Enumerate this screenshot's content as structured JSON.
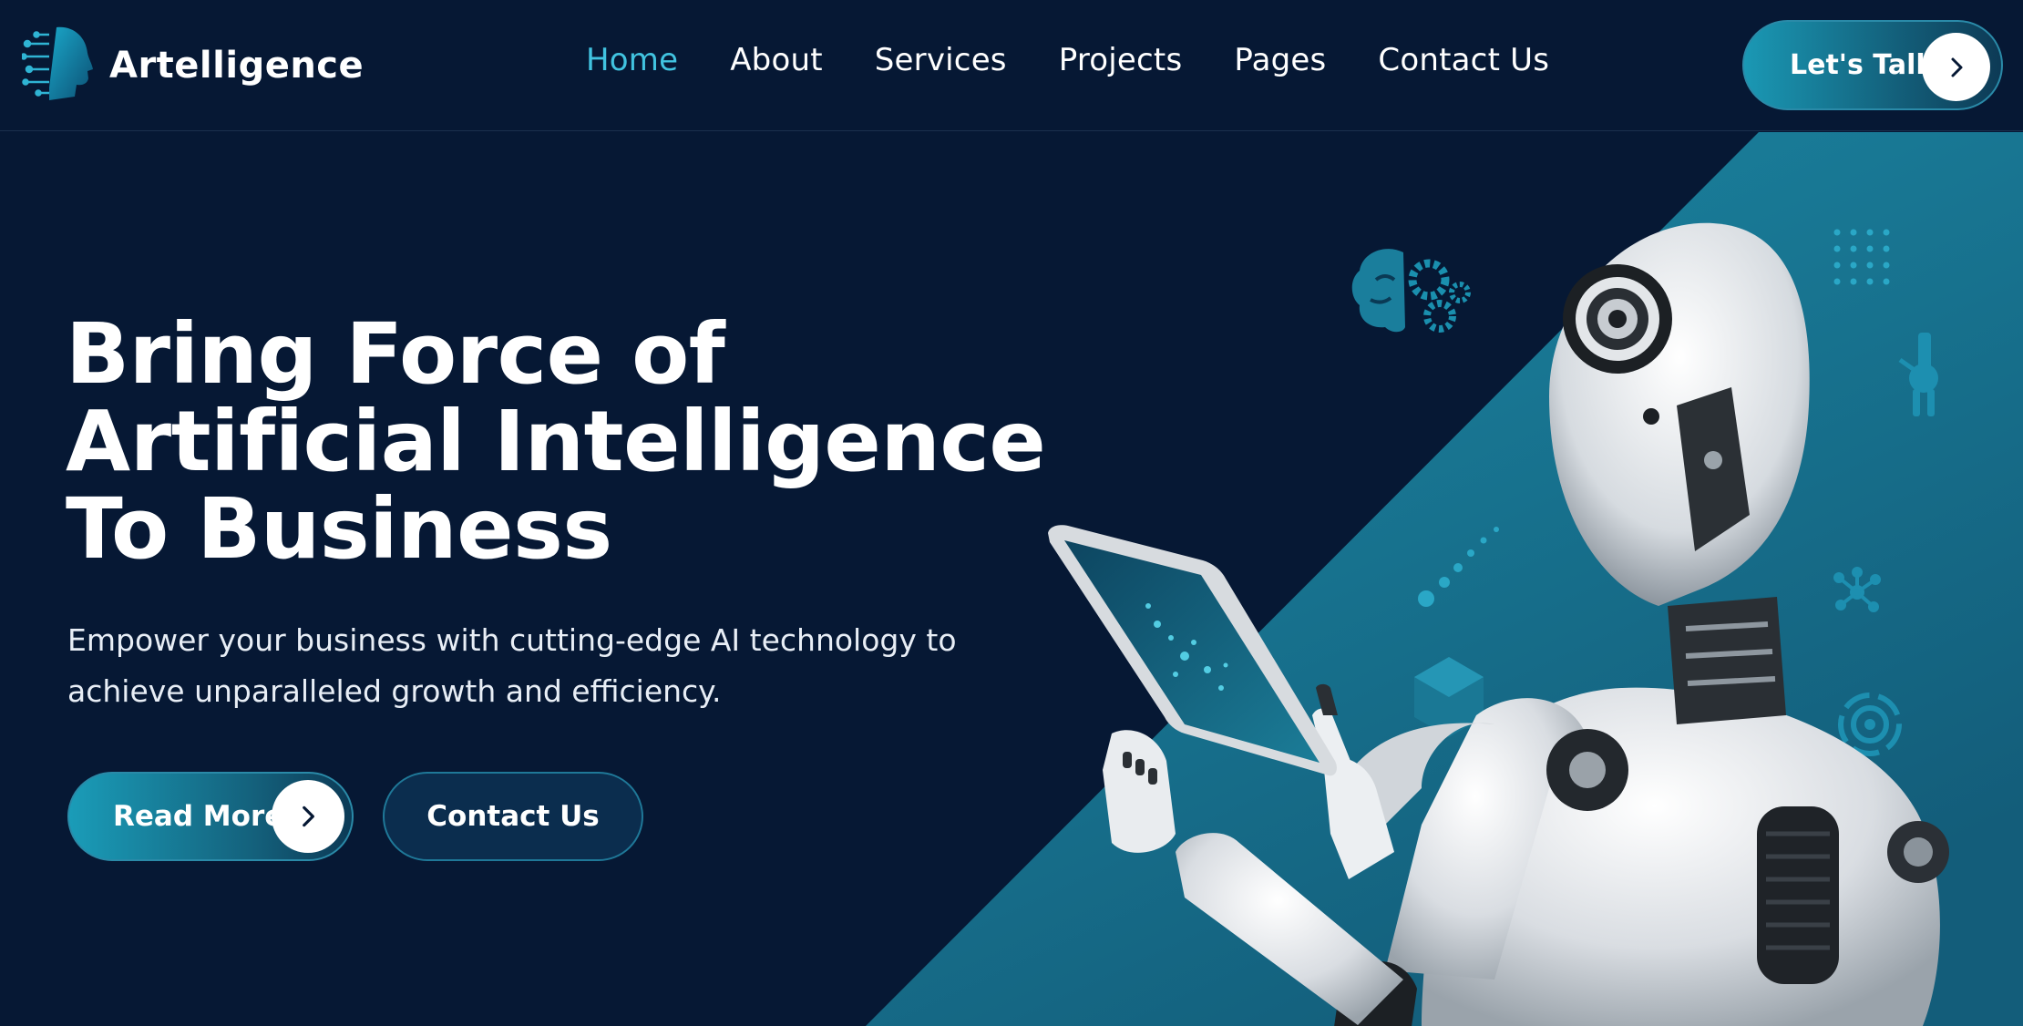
{
  "brand": {
    "name": "Artelligence"
  },
  "nav": {
    "items": [
      {
        "label": "Home",
        "active": true
      },
      {
        "label": "About",
        "active": false
      },
      {
        "label": "Services",
        "active": false
      },
      {
        "label": "Projects",
        "active": false
      },
      {
        "label": "Pages",
        "active": false
      },
      {
        "label": "Contact Us",
        "active": false
      }
    ],
    "cta_label": "Let's Talk"
  },
  "hero": {
    "title_lines": [
      "Bring Force of",
      "Artificial Intelligence",
      "To Business"
    ],
    "description": "Empower your business with cutting-edge AI technology to achieve unparalleled growth and efficiency.",
    "primary_button": "Read More",
    "secondary_button": "Contact Us"
  },
  "colors": {
    "background": "#061834",
    "accent": "#41c3e0",
    "teal_panel": "#17718c",
    "button_gradient_start": "#1a9cb8"
  },
  "icons": [
    "logo-head-icon",
    "chevron-right-icon",
    "brain-gear-icon",
    "dot-grid-icon",
    "robot-arm-icon",
    "network-icon",
    "target-icon",
    "hexagon-icon",
    "robot-illustration"
  ]
}
